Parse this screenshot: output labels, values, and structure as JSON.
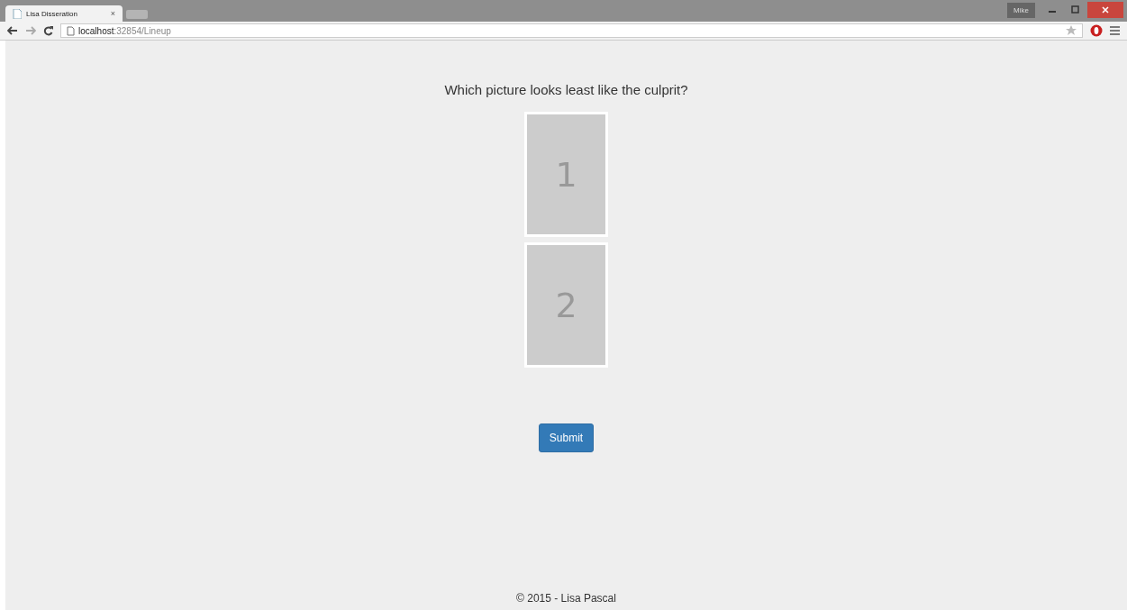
{
  "browser": {
    "tab_title": "Lisa Disseration",
    "tab_close": "×",
    "user": "Mike",
    "url_host": "localhost",
    "url_path": ":32854/Lineup"
  },
  "question": "Which picture looks least like the culprit?",
  "pictures": [
    {
      "label": "1"
    },
    {
      "label": "2"
    }
  ],
  "submit": "Submit",
  "footer": "© 2015 - Lisa Pascal"
}
